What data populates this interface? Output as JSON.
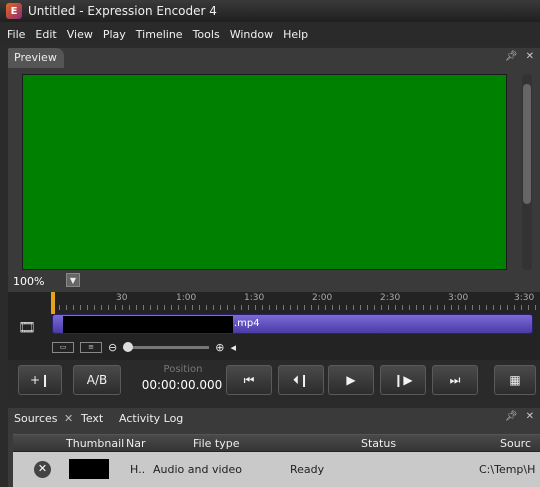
{
  "window": {
    "title": "Untitled - Expression Encoder 4"
  },
  "menu": [
    "File",
    "Edit",
    "View",
    "Play",
    "Timeline",
    "Tools",
    "Window",
    "Help"
  ],
  "preview": {
    "tab_label": "Preview",
    "zoom": "100%",
    "video_color": "#008000"
  },
  "timeline": {
    "ticks": [
      "30",
      "1:00",
      "1:30",
      "2:00",
      "2:30",
      "3:00",
      "3:30"
    ],
    "clip_suffix": ".mp4",
    "clip_color": "#5b4ac0",
    "playhead_color": "#e5a31b"
  },
  "transport": {
    "ab_label": "A/B",
    "position_label": "Position",
    "position_value": "00:00:00.000"
  },
  "sources": {
    "tabs": [
      "Sources",
      "Text",
      "Activity Log"
    ],
    "columns": {
      "thumbnail": "Thumbnail",
      "name": "Nar",
      "file_type": "File type",
      "status": "Status",
      "source": "Sourc"
    },
    "row": {
      "name": "H..",
      "file_type": "Audio and video",
      "status": "Ready",
      "source": "C:\\Temp\\H"
    }
  }
}
